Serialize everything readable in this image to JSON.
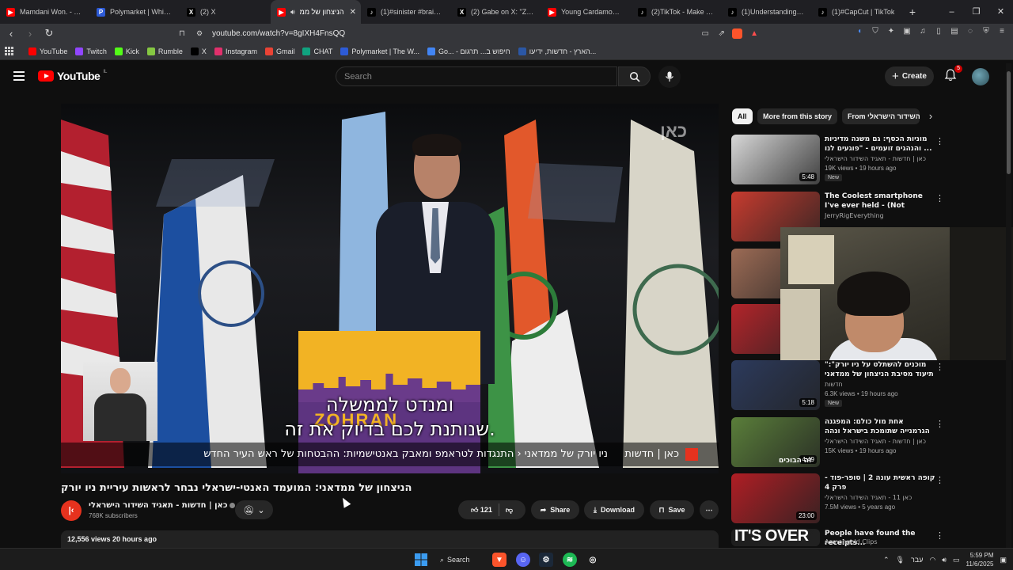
{
  "browser": {
    "tabs": [
      {
        "title": "Mamdani Won. - YouTube",
        "icon": "youtube-icon",
        "color": "#ff0000",
        "active": false
      },
      {
        "title": "Polymarket | Which party",
        "icon": "polymarket-icon",
        "color": "#2d5bd7",
        "active": false
      },
      {
        "title": "(2) X",
        "icon": "x-icon",
        "color": "#000000",
        "active": false
      },
      {
        "title": "הניצחון של ממ",
        "icon": "youtube-icon",
        "color": "#ff0000",
        "active": true
      },
      {
        "title": "(1)#sinister #brainrot #",
        "icon": "tiktok-icon",
        "color": "#000000",
        "active": false
      },
      {
        "title": "(2) Gabe on X: \"Zelensky",
        "icon": "x-icon",
        "color": "#000000",
        "active": false
      },
      {
        "title": "Young Cardamom & HAN",
        "icon": "youtube-icon",
        "color": "#ff0000",
        "active": false
      },
      {
        "title": "(2)TikTok - Make Your Day",
        "icon": "tiktok-icon",
        "color": "#000000",
        "active": false
      },
      {
        "title": "(1)Understanding the",
        "icon": "tiktok-icon",
        "color": "#000000",
        "active": false
      },
      {
        "title": "(1)#CapCut | TikTok",
        "icon": "tiktok-icon",
        "color": "#000000",
        "active": false
      }
    ],
    "url": "youtube.com/watch?v=8gIXH4FnsQQ",
    "bookmarks": [
      {
        "label": "YouTube",
        "icon": "youtube-icon",
        "color": "#ff0000"
      },
      {
        "label": "Twitch",
        "icon": "twitch-icon",
        "color": "#9146ff"
      },
      {
        "label": "Kick",
        "icon": "kick-icon",
        "color": "#53fc18"
      },
      {
        "label": "Rumble",
        "icon": "rumble-icon",
        "color": "#85c742"
      },
      {
        "label": "X",
        "icon": "x-icon",
        "color": "#000000"
      },
      {
        "label": "Instagram",
        "icon": "instagram-icon",
        "color": "#e1306c"
      },
      {
        "label": "Gmail",
        "icon": "gmail-icon",
        "color": "#ea4335"
      },
      {
        "label": "CHAT",
        "icon": "chatgpt-icon",
        "color": "#10a37f"
      },
      {
        "label": "Polymarket | The W...",
        "icon": "polymarket-icon",
        "color": "#2d5bd7"
      },
      {
        "label": "Go... - חיפוש ב... תרגום",
        "icon": "google-icon",
        "color": "#4285f4"
      },
      {
        "label": "הארץ - חדשות, ידיעו...",
        "icon": "haaretz-icon",
        "color": "#2b57a5"
      }
    ]
  },
  "youtube": {
    "country_code": "IL",
    "logo_text": "YouTube",
    "search_placeholder": "Search",
    "create_label": "Create",
    "notifications": "5",
    "chips": [
      "All",
      "More from this story",
      "From השידור הישראלי"
    ],
    "video": {
      "subtitle_line1": "ומנדט לממשלה",
      "subtitle_line2": "שנותנת לכם בדיוק את זה.",
      "ticker_brand": "כאן | חדשות",
      "ticker_text": "ניו יורק של ממדאני ‹ התנגדות לטראמפ ומאבק באנטישמיות: ההבטחות של ראש העיר החדש",
      "channel_bug": "כאן",
      "podium_text": "ZOHRAN"
    },
    "title": "הניצחון של ממדאני: המועמד האנטי-ישראלי נבחר לראשות עיריית ניו יורק",
    "channel": {
      "name": "כאן | חדשות - תאגיד השידור הישראלי",
      "subscribers": "768K subscribers"
    },
    "actions": {
      "likes": "121",
      "share": "Share",
      "download": "Download",
      "save": "Save"
    },
    "views_line": "12,556 views  20 hours ago",
    "recommendations": [
      {
        "title": "מוניות הכסף: גם משנה מדיניות והנהגים זועמים - \"פוגעים לנו ...",
        "channel": "כאן | חדשות - תאגיד השידור הישראלי",
        "meta": "19K views • 19 hours ago",
        "badge": "New",
        "duration": "5:48",
        "thumb_color": "#d8d8d8"
      },
      {
        "title": "The Coolest smartphone I've ever held - (Not Clickbait)",
        "channel": "JerryRigEverything",
        "meta": "",
        "badge": "",
        "duration": "",
        "thumb_color": "#c73b2f"
      },
      {
        "title": "",
        "channel": "",
        "meta": "",
        "badge": "",
        "duration": "",
        "thumb_color": "#9c6b55"
      },
      {
        "title": "",
        "channel": "",
        "meta": "",
        "badge": "",
        "duration": "",
        "thumb_color": "#b3242a"
      },
      {
        "title": "\"מוכנים להשתלט על ניו יורק\": תיעוד מסיבת הניצחון של ממדאני",
        "channel": "חדשות",
        "meta": "6.3K views • 19 hours ago",
        "badge": "New",
        "duration": "5:18",
        "thumb_color": "#2c3a5c"
      },
      {
        "title": "אחת מול כולם: המפגנה הגרמנייה שתומכת בישראל ונהה ברסם ...",
        "channel": "כאן | חדשות - תאגיד השידור הישראלי",
        "meta": "15K views • 19 hours ago",
        "badge": "",
        "duration": "4:49",
        "thumb_color": "#5a7e3a"
      },
      {
        "title": "קופה ראשית עונה 2 | סופר-פוד - פרק 4",
        "channel": "כאן 11 - תאגיד השידור הישראלי",
        "meta": "7.5M views • 5 years ago",
        "badge": "",
        "duration": "23:00",
        "thumb_color": "#b01e24"
      },
      {
        "title": "People have found the receipts...",
        "channel": "Asmongold Clips",
        "meta": "",
        "badge": "",
        "duration": "",
        "thumb_color": "#1e1e1e"
      }
    ],
    "thumb_caption_5": "זה הבוכים",
    "thumb_caption_7": "IT'S OVER"
  },
  "taskbar": {
    "search_label": "Search",
    "lang": "עבר",
    "time": "5:59 PM",
    "date": "11/6/2025"
  }
}
